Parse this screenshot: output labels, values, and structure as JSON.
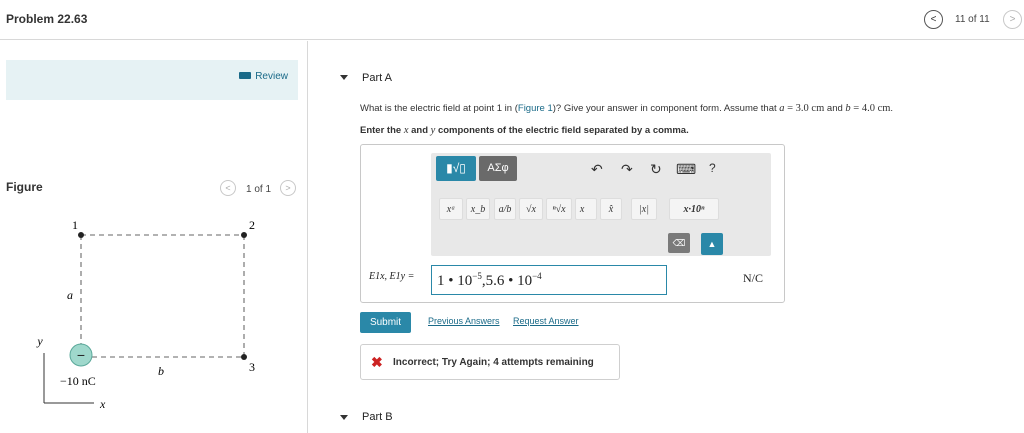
{
  "header": {
    "problem_title": "Problem 22.63",
    "counter": "11 of 11",
    "prev_symbol": "<",
    "next_symbol": ">"
  },
  "sidebar": {
    "review_label": "Review",
    "figure_label": "Figure",
    "figure_counter": "1 of 1",
    "figure": {
      "point1_label": "1",
      "point2_label": "2",
      "point3_label": "3",
      "side_a_label": "a",
      "side_b_label": "b",
      "axis_x_label": "x",
      "axis_y_label": "y",
      "charge_symbol": "−",
      "charge_label": "−10 nC"
    }
  },
  "part_a": {
    "title": "Part A",
    "question_pre": "What is the electric field at point 1 in (",
    "question_link": "Figure 1",
    "question_mid": ")? Give your answer in component form. Assume that ",
    "var_a": "a",
    "eq_a": " = 3.0 cm",
    "and_text": " and ",
    "var_b": "b",
    "eq_b": " = 4.0 cm",
    "end_text": ".",
    "instruction_pre": "Enter the ",
    "var_x": "x",
    "instruction_mid": " and ",
    "var_y": "y",
    "instruction_post": " components of the electric field separated by a comma.",
    "toolbar": {
      "template_label": "▮√▯",
      "greek_label": "ΑΣφ",
      "undo_icon": "↶",
      "redo_icon": "↷",
      "reset_icon": "↻",
      "keyboard_icon": "⌨",
      "help_icon": "?",
      "symbols": [
        "xᵃ",
        "x_b",
        "a/b",
        "√x",
        "ⁿ√x",
        "x⃗",
        "x̂",
        "|x|",
        "x·10ⁿ"
      ],
      "delete_icon": "⌫",
      "keypad_icon": "▲"
    },
    "answer_label": "E1x, E1y =",
    "answer_value_1": "1 • 10",
    "answer_exp_1": "−5",
    "answer_value_2": ",5.6 • 10",
    "answer_exp_2": "−4",
    "unit": "N/C",
    "submit_label": "Submit",
    "previous_answers_label": "Previous Answers",
    "request_answer_label": "Request Answer",
    "feedback_icon": "✖",
    "feedback_text": "Incorrect; Try Again; 4 attempts remaining"
  },
  "part_b": {
    "title": "Part B"
  },
  "colors": {
    "accent": "#2a88a8",
    "link": "#1a6a88",
    "review_bg": "#e6f2f4",
    "error": "#cc2222",
    "charge_fill": "#9fd8cc"
  }
}
